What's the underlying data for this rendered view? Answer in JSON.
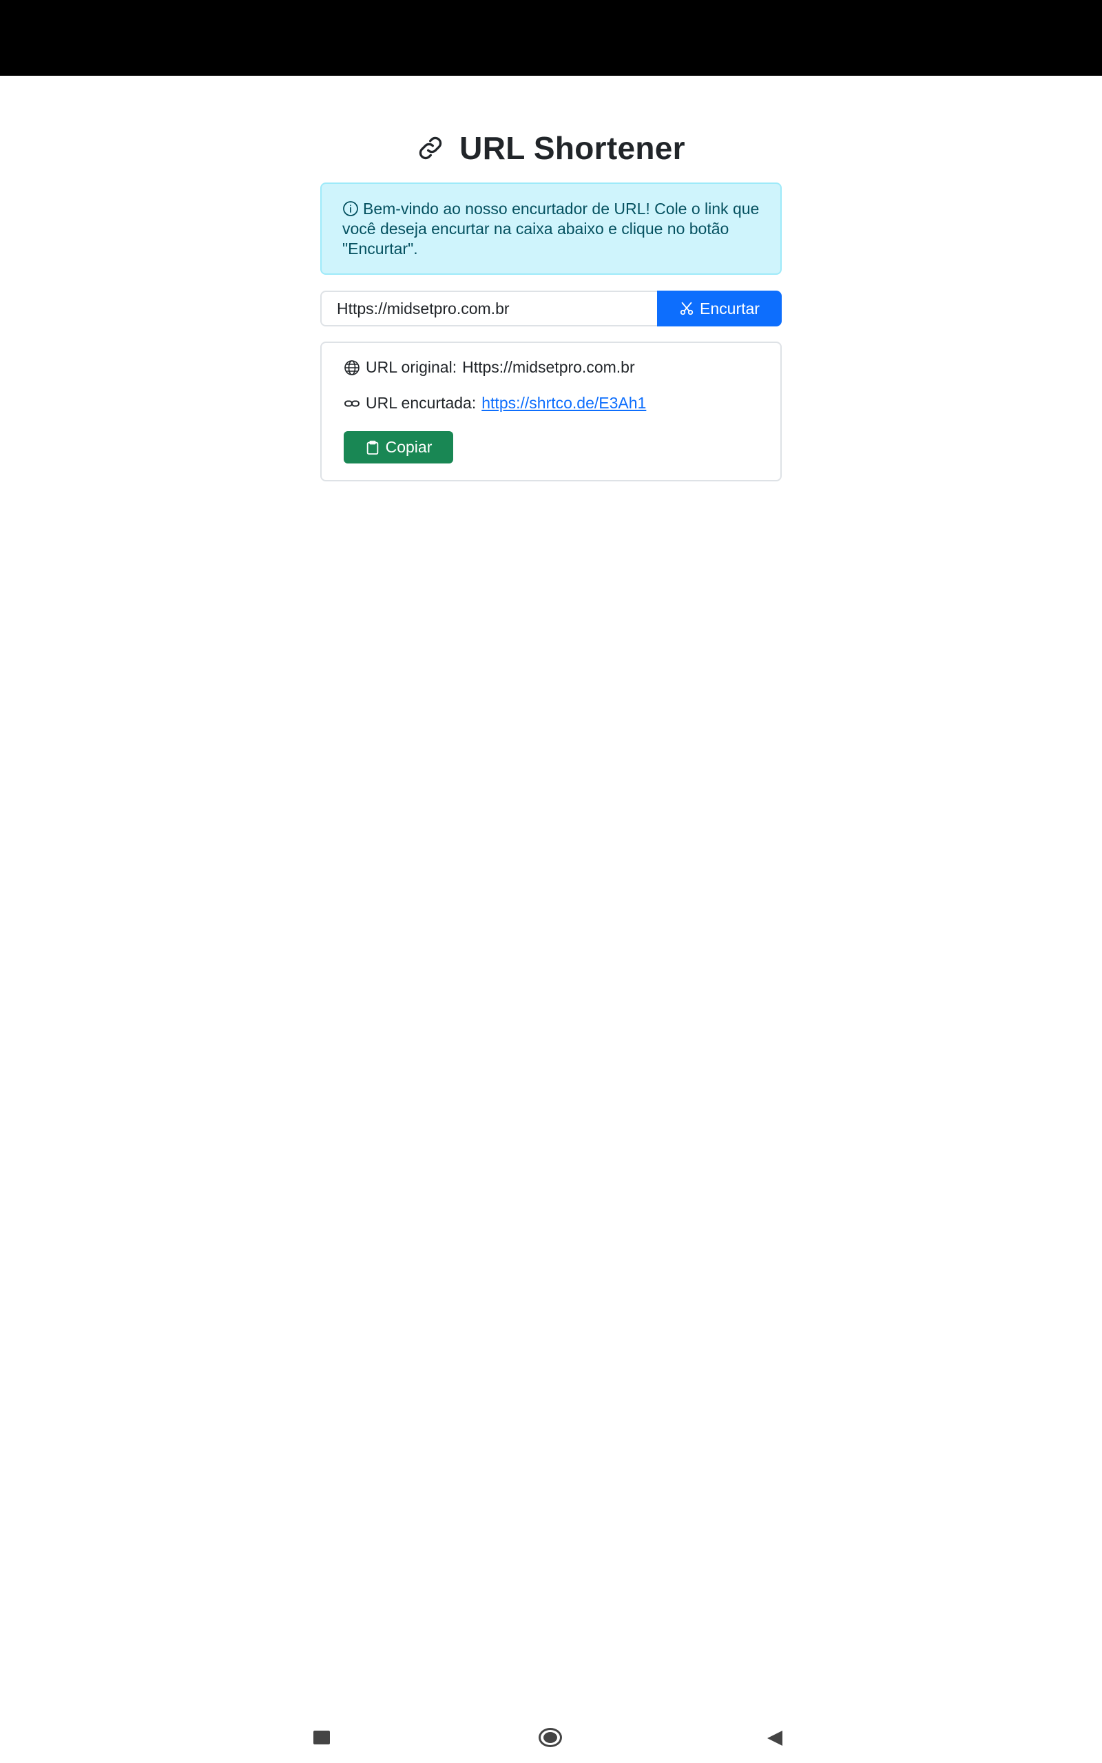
{
  "header": {
    "title": "URL Shortener",
    "icon": "link-icon"
  },
  "alert": {
    "icon": "info-circle-icon",
    "message": "Bem-vindo ao nosso encurtador de URL! Cole o link que você deseja encurtar na caixa abaixo e clique no botão \"Encurtar\"."
  },
  "form": {
    "url_value": "Https://midsetpro.com.br",
    "shorten_label": "Encurtar",
    "shorten_icon": "scissors-icon"
  },
  "result": {
    "original_label": "URL original:",
    "original_value": "Https://midsetpro.com.br",
    "original_icon": "globe-icon",
    "short_label": "URL encurtada:",
    "short_value": "https://shrtco.de/E3Ah1",
    "short_icon": "link-icon",
    "copy_label": "Copiar",
    "copy_icon": "clipboard-icon"
  },
  "colors": {
    "primary": "#0d6efd",
    "success": "#198754",
    "info_bg": "#cff4fc",
    "info_text": "#055160"
  },
  "navbar": {
    "icons": [
      "recents-icon",
      "home-icon",
      "back-icon"
    ]
  }
}
